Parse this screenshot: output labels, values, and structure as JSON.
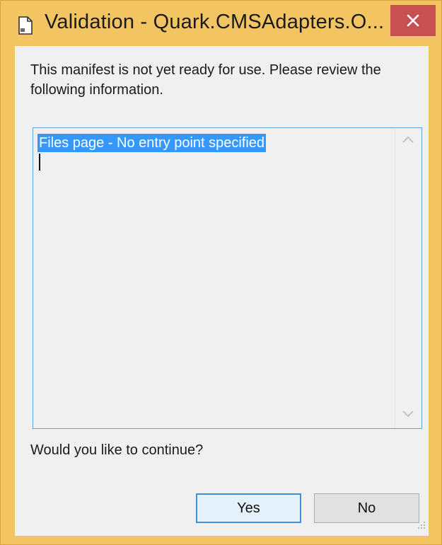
{
  "window": {
    "title": "Validation - Quark.CMSAdapters.O...",
    "close_symbol": "✕"
  },
  "dialog": {
    "message": "This manifest is not yet ready for use. Please review the following information.",
    "details_text": "Files page - No entry point specified",
    "question": "Would you like to continue?",
    "yes_label": "Yes",
    "no_label": "No"
  },
  "icons": {
    "title": "document-icon",
    "close": "close-icon",
    "scroll_up": "chevron-up-icon",
    "scroll_down": "chevron-down-icon",
    "resize": "resize-grip-icon"
  },
  "colors": {
    "frame": "#f3c562",
    "close_button": "#c75050",
    "selection": "#3399ff",
    "focus_border": "#3c8fd9"
  }
}
